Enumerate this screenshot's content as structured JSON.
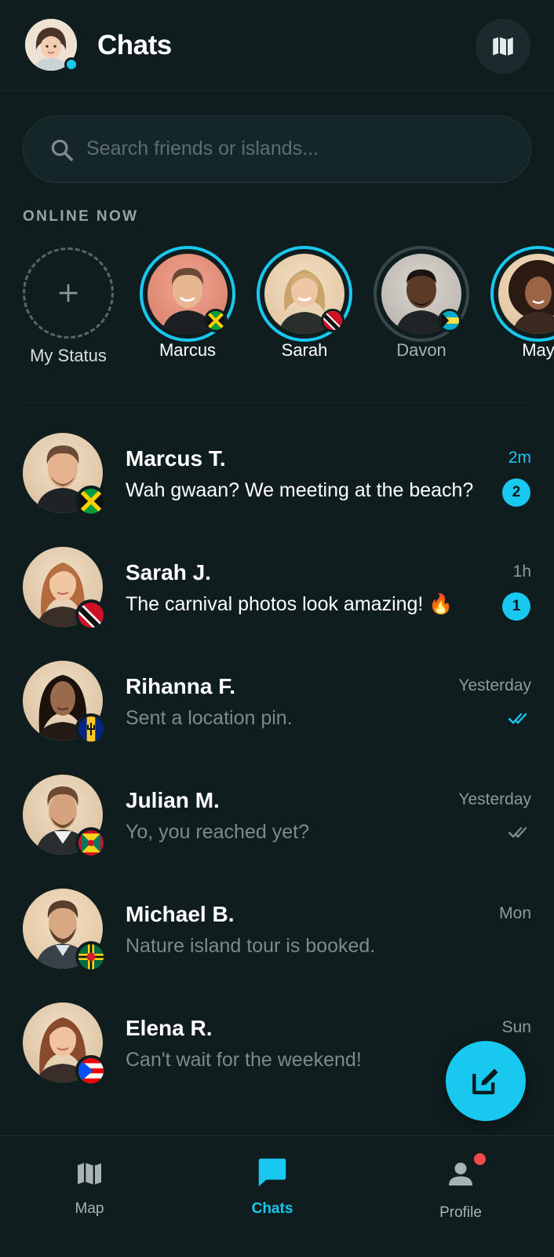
{
  "header": {
    "title": "Chats"
  },
  "search": {
    "placeholder": "Search friends or islands..."
  },
  "online": {
    "label": "ONLINE NOW",
    "my_status": "My Status",
    "people": [
      {
        "name": "Marcus",
        "online": true,
        "flag": "jamaica"
      },
      {
        "name": "Sarah",
        "online": true,
        "flag": "trinidad"
      },
      {
        "name": "Davon",
        "online": false,
        "flag": "bahamas"
      },
      {
        "name": "May",
        "online": true,
        "flag": "none"
      }
    ]
  },
  "chats": [
    {
      "name": "Marcus T.",
      "message": "Wah gwaan? We meeting at the beach?",
      "time": "2m",
      "unread": "2",
      "flag": "jamaica"
    },
    {
      "name": "Sarah J.",
      "message": "The carnival photos look amazing! 🔥",
      "time": "1h",
      "unread": "1",
      "flag": "trinidad"
    },
    {
      "name": "Rihanna F.",
      "message": "Sent a location pin.",
      "time": "Yesterday",
      "status": "read",
      "flag": "barbados"
    },
    {
      "name": "Julian M.",
      "message": "Yo, you reached yet?",
      "time": "Yesterday",
      "status": "delivered",
      "flag": "grenada"
    },
    {
      "name": "Michael B.",
      "message": "Nature island tour is booked.",
      "time": "Mon",
      "flag": "dominica"
    },
    {
      "name": "Elena R.",
      "message": "Can't wait for the weekend!",
      "time": "Sun",
      "flag": "puerto-rico"
    }
  ],
  "nav": {
    "map": "Map",
    "chats": "Chats",
    "profile": "Profile"
  },
  "colors": {
    "accent": "#18c8ef",
    "background": "#0f1d1f",
    "notification": "#f04b4b"
  },
  "icons": [
    "map-icon",
    "search-icon",
    "plus-icon",
    "compose-icon",
    "chat-bubble-icon",
    "person-icon",
    "double-check-icon"
  ]
}
